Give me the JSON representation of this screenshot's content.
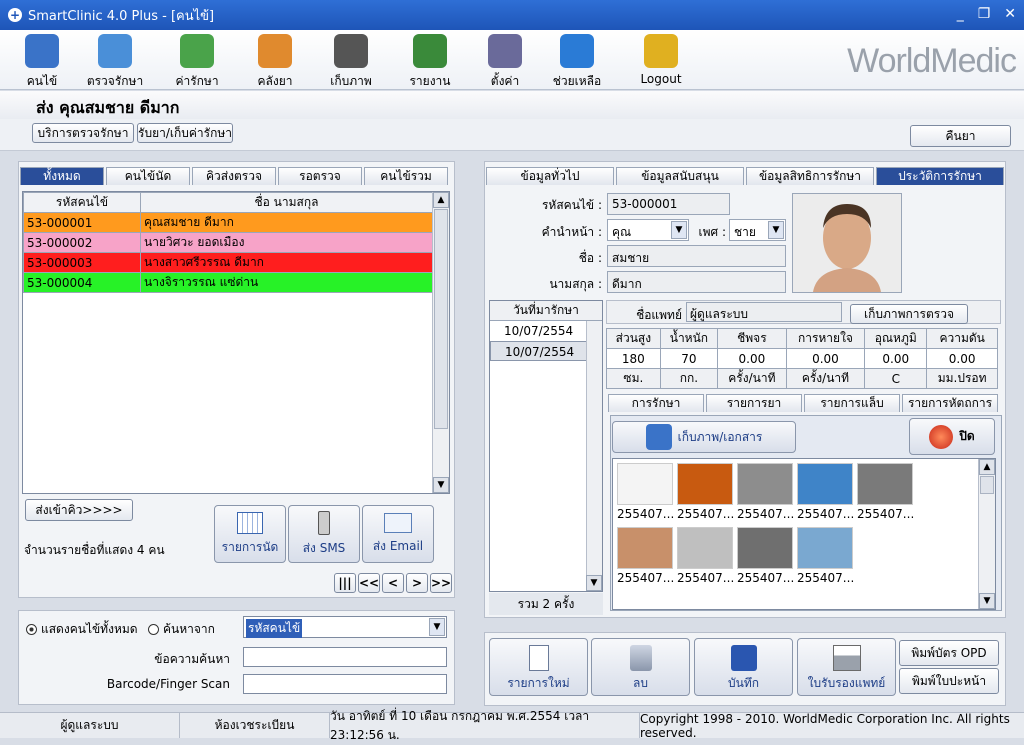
{
  "window": {
    "title": "SmartClinic 4.0 Plus - [คนไข้]"
  },
  "toolbar": {
    "items": [
      {
        "label": "คนไข้",
        "icon": "patient-folder-icon",
        "color": "#3a73c8"
      },
      {
        "label": "ตรวจรักษา",
        "icon": "doctor-icon",
        "color": "#4a8fd8"
      },
      {
        "label": "ค่ารักษา",
        "icon": "money-icon",
        "color": "#4aa34a"
      },
      {
        "label": "คลังยา",
        "icon": "pill-icon",
        "color": "#e08a2e"
      },
      {
        "label": "เก็บภาพ",
        "icon": "camera-icon",
        "color": "#555555"
      },
      {
        "label": "รายงาน",
        "icon": "bar-chart-icon",
        "color": "#3a8a3a"
      },
      {
        "label": "ตั้งค่า",
        "icon": "tools-icon",
        "color": "#6a6a9a"
      },
      {
        "label": "ช่วยเหลือ",
        "icon": "help-icon",
        "color": "#2a7bd6"
      },
      {
        "label": "Logout",
        "icon": "lock-icon",
        "color": "#e0b020"
      }
    ],
    "logo": "WorldMedic"
  },
  "patient_header": "ส่ง  คุณสมชาย ดีมาก",
  "subbar": {
    "service_btn": "บริการตรวจรักษา",
    "pay_btn": "รับยา/เก็บค่ารักษา",
    "back_btn": "คืนยา"
  },
  "left": {
    "tabs": [
      "ทั้งหมด",
      "คนไข้นัด",
      "คิวส่งตรวจ",
      "รอตรวจ",
      "คนไข้รวม"
    ],
    "columns": [
      "รหัสคนไข้",
      "ชื่อ นามสกุล"
    ],
    "rows": [
      {
        "id": "53-000001",
        "name": "คุณสมชาย ดีมาก",
        "color": "#ff9a1e"
      },
      {
        "id": "53-000002",
        "name": "นายวิศวะ ยอดเมือง",
        "color": "#f7a3c8"
      },
      {
        "id": "53-000003",
        "name": "นางสาวศรีวรรณ ดีมาก",
        "color": "#ff1e1e"
      },
      {
        "id": "53-000004",
        "name": "นางจิราวรรณ แซ่ด่าน",
        "color": "#27f227"
      }
    ],
    "queue_btn": "ส่งเข้าคิว>>>>",
    "count_text": "จำนวนรายชื่อที่แสดง 4 คน",
    "appt_btn": "รายการนัด",
    "sms_btn": "ส่ง SMS",
    "email_btn": "ส่ง Email",
    "pager": [
      "|||",
      "<<",
      "<",
      ">",
      ">>"
    ]
  },
  "search": {
    "radio_all": "แสดงคนไข้ทั้งหมด",
    "radio_search": "ค้นหาจาก",
    "search_field": "รหัสคนไข้",
    "text_label": "ข้อความค้นหา",
    "barcode_label": "Barcode/Finger Scan",
    "text_value": "",
    "barcode_value": ""
  },
  "right": {
    "tabs": [
      "ข้อมูลทั่วไป",
      "ข้อมูลสนับสนุน",
      "ข้อมูลสิทธิการรักษา",
      "ประวัติการรักษา"
    ],
    "labels": {
      "id": "รหัสคนไข้ :",
      "prefix": "คำนำหน้า :",
      "sex": "เพศ :",
      "fname": "ชื่อ :",
      "lname": "นามสกุล :"
    },
    "values": {
      "id": "53-000001",
      "prefix": "คุณ",
      "sex": "ชาย",
      "fname": "สมชาย",
      "lname": "ดีมาก"
    },
    "visit_header": "วันที่มารักษา",
    "visits": [
      "10/07/2554",
      "10/07/2554"
    ],
    "visit_total": "รวม 2 ครั้ง",
    "doctor_label": "ชื่อแพทย์",
    "doctor_value": "ผู้ดูแลระบบ",
    "exam_img_btn": "เก็บภาพการตรวจ",
    "vitals_head": [
      "ส่วนสูง",
      "น้ำหนัก",
      "ชีพจร",
      "การหายใจ",
      "อุณหภูมิ",
      "ความดัน"
    ],
    "vitals_values": [
      "180",
      "70",
      "0.00",
      "0.00",
      "0.00",
      "0.00"
    ],
    "vitals_units": [
      "ซม.",
      "กก.",
      "ครั้ง/นาที",
      "ครั้ง/นาที",
      "C",
      "มม.ปรอท"
    ],
    "sub_tabs": [
      "การรักษา",
      "รายการยา",
      "รายการแล็บ",
      "รายการหัตถการ"
    ],
    "doc_btn": "เก็บภาพ/เอกสาร",
    "close_btn": "ปิด",
    "thumbs": [
      {
        "label": "255407...",
        "color": "#f4f4f4"
      },
      {
        "label": "255407...",
        "color": "#c85a10"
      },
      {
        "label": "255407...",
        "color": "#8d8d8d"
      },
      {
        "label": "255407...",
        "color": "#3f84c8"
      },
      {
        "label": "255407...",
        "color": "#7a7a7a"
      },
      {
        "label": "255407...",
        "color": "#c8906a"
      },
      {
        "label": "255407...",
        "color": "#bfbfbf"
      },
      {
        "label": "255407...",
        "color": "#6f6f6f"
      },
      {
        "label": "255407...",
        "color": "#7aa8d0"
      }
    ]
  },
  "actions": {
    "new": "รายการใหม่",
    "delete": "ลบ",
    "save": "บันทึก",
    "cert": "ใบรับรองแพทย์",
    "opd": "พิมพ์บัตร OPD",
    "cover": "พิมพ์ใบปะหน้า"
  },
  "status": {
    "user": "ผู้ดูแลระบบ",
    "room": "ห้องเวชระเบียน",
    "datetime": "วัน อาทิตย์ ที่ 10 เดือน กรกฎาคม พ.ศ.2554 เวลา 23:12:56 น.",
    "copyright": "Copyright 1998 - 2010. WorldMedic Corporation Inc. All rights reserved."
  }
}
